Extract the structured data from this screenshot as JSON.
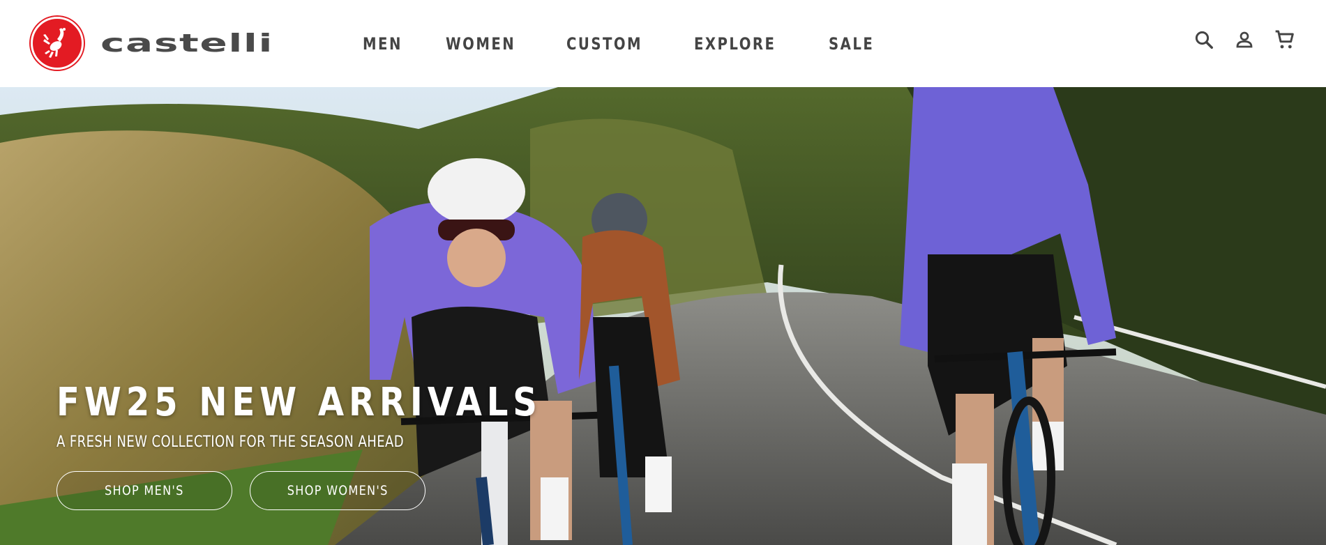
{
  "brand": {
    "name": "castelli",
    "logo_icon": "scorpion-icon",
    "accent": "#e31b23"
  },
  "nav": {
    "items": [
      "MEN",
      "WOMEN",
      "CUSTOM",
      "EXPLORE",
      "SALE"
    ]
  },
  "utility": {
    "icons": [
      "search-icon",
      "account-icon",
      "cart-icon"
    ]
  },
  "hero": {
    "title": "FW25 NEW ARRIVALS",
    "subtitle": "A FRESH NEW COLLECTION FOR THE SEASON AHEAD",
    "ctas": [
      "SHOP MEN'S",
      "SHOP WOMEN'S"
    ]
  }
}
